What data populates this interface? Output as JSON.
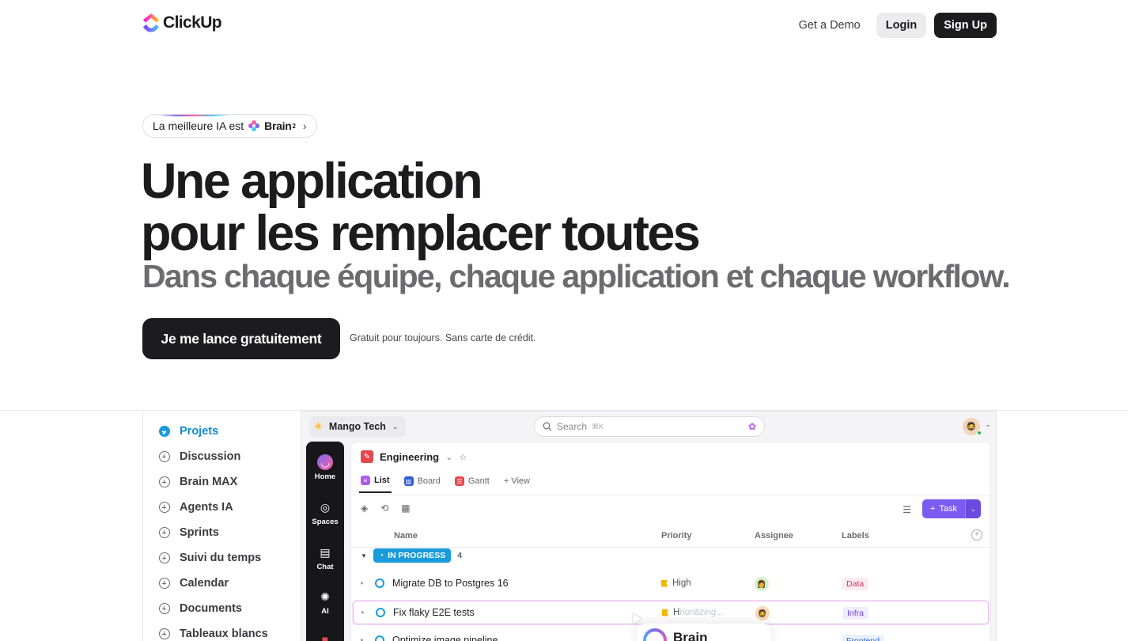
{
  "nav": {
    "brand": "ClickUp",
    "demo": "Get a Demo",
    "login": "Login",
    "signup": "Sign Up"
  },
  "hero": {
    "pill_text": "La meilleure IA est",
    "pill_brand": "Brain",
    "pill_sup": "2",
    "title_line1": "Une application",
    "title_line2": "pour les remplacer toutes",
    "subtitle": "Dans chaque équipe, chaque application et chaque workflow.",
    "cta": "Je me lance gratuitement",
    "cta_note": "Gratuit pour toujours. Sans carte de crédit."
  },
  "features": [
    {
      "label": "Projets",
      "active": true
    },
    {
      "label": "Discussion"
    },
    {
      "label": "Brain MAX"
    },
    {
      "label": "Agents IA"
    },
    {
      "label": "Sprints"
    },
    {
      "label": "Suivi du temps"
    },
    {
      "label": "Calendar"
    },
    {
      "label": "Documents"
    },
    {
      "label": "Tableaux blancs"
    }
  ],
  "app": {
    "workspace": "Mango Tech",
    "search_placeholder": "Search",
    "search_shortcut": "⌘K",
    "rail": [
      {
        "label": "Home",
        "icon": "home-icon"
      },
      {
        "label": "Spaces",
        "icon": "planet-icon"
      },
      {
        "label": "Chat",
        "icon": "chat-icon"
      },
      {
        "label": "AI",
        "icon": "ai-icon"
      }
    ],
    "space": "Engineering",
    "tabs": [
      {
        "label": "List",
        "color": "#b05ce6"
      },
      {
        "label": "Board",
        "color": "#2f5bd8"
      },
      {
        "label": "Gantt",
        "color": "#e5484d"
      }
    ],
    "add_view": "+ View",
    "task_button": "Task",
    "columns": {
      "name": "Name",
      "priority": "Priority",
      "assignee": "Assignee",
      "labels": "Labels"
    },
    "status": {
      "label": "IN PROGRESS",
      "count": "4",
      "color": "#1a9bdb"
    },
    "rows": [
      {
        "name": "Migrate DB to Postgres 16",
        "priority": "High",
        "label": "Data"
      },
      {
        "name": "Fix flaky E2E tests",
        "priority": "H",
        "priority_ghost": "rioritizing...",
        "label": "Infra"
      },
      {
        "name": "Optimize image pipeline",
        "priority": "",
        "label": "Frontend"
      }
    ],
    "brain_popup": "Brain"
  }
}
